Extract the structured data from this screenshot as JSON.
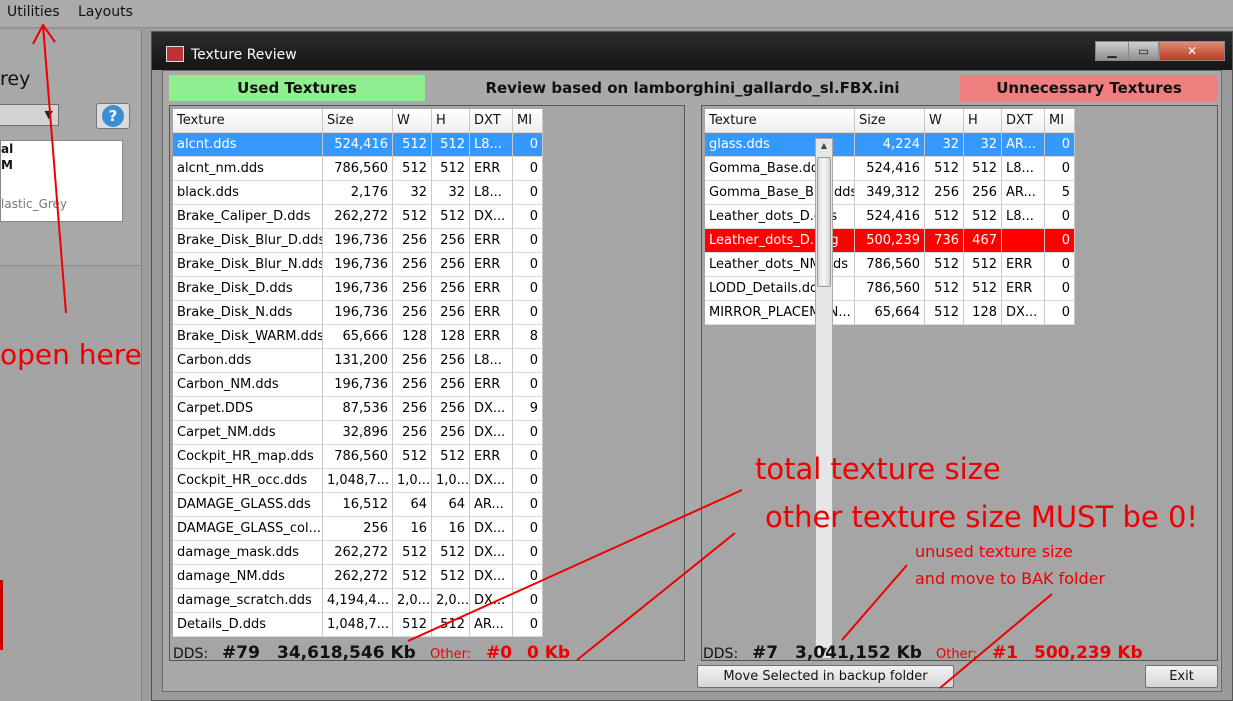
{
  "menu": {
    "utilities": "Utilities",
    "layouts": "Layouts"
  },
  "left_panel": {
    "title_fragment": "rey",
    "list": [
      "al",
      "M",
      "lastic_Grey"
    ]
  },
  "window": {
    "title": "Texture Review"
  },
  "headers": {
    "used": "Used Textures",
    "review": "Review based on lamborghini_gallardo_sl.FBX.ini",
    "unnecessary": "Unnecessary Textures",
    "used_bg": "#90f090",
    "unnecessary_bg": "#f08080"
  },
  "columns": [
    "Texture",
    "Size",
    "W",
    "H",
    "DXT",
    "MI"
  ],
  "used_rows": [
    [
      "alcnt.dds",
      "524,416",
      "512",
      "512",
      "L8...",
      "0"
    ],
    [
      "alcnt_nm.dds",
      "786,560",
      "512",
      "512",
      "ERR",
      "0"
    ],
    [
      "black.dds",
      "2,176",
      "32",
      "32",
      "L8...",
      "0"
    ],
    [
      "Brake_Caliper_D.dds",
      "262,272",
      "512",
      "512",
      "DX...",
      "0"
    ],
    [
      "Brake_Disk_Blur_D.dds",
      "196,736",
      "256",
      "256",
      "ERR",
      "0"
    ],
    [
      "Brake_Disk_Blur_N.dds",
      "196,736",
      "256",
      "256",
      "ERR",
      "0"
    ],
    [
      "Brake_Disk_D.dds",
      "196,736",
      "256",
      "256",
      "ERR",
      "0"
    ],
    [
      "Brake_Disk_N.dds",
      "196,736",
      "256",
      "256",
      "ERR",
      "0"
    ],
    [
      "Brake_Disk_WARM.dds",
      "65,666",
      "128",
      "128",
      "ERR",
      "8"
    ],
    [
      "Carbon.dds",
      "131,200",
      "256",
      "256",
      "L8...",
      "0"
    ],
    [
      "Carbon_NM.dds",
      "196,736",
      "256",
      "256",
      "ERR",
      "0"
    ],
    [
      "Carpet.DDS",
      "87,536",
      "256",
      "256",
      "DX...",
      "9"
    ],
    [
      "Carpet_NM.dds",
      "32,896",
      "256",
      "256",
      "DX...",
      "0"
    ],
    [
      "Cockpit_HR_map.dds",
      "786,560",
      "512",
      "512",
      "ERR",
      "0"
    ],
    [
      "Cockpit_HR_occ.dds",
      "1,048,7...",
      "1,0...",
      "1,0...",
      "DX...",
      "0"
    ],
    [
      "DAMAGE_GLASS.dds",
      "16,512",
      "64",
      "64",
      "AR...",
      "0"
    ],
    [
      "DAMAGE_GLASS_col...",
      "256",
      "16",
      "16",
      "DX...",
      "0"
    ],
    [
      "damage_mask.dds",
      "262,272",
      "512",
      "512",
      "DX...",
      "0"
    ],
    [
      "damage_NM.dds",
      "262,272",
      "512",
      "512",
      "DX...",
      "0"
    ],
    [
      "damage_scratch.dds",
      "4,194,4...",
      "2,0...",
      "2,0...",
      "DX...",
      "0"
    ],
    [
      "Details_D.dds",
      "1,048,7...",
      "512",
      "512",
      "AR...",
      "0"
    ]
  ],
  "unnecessary_rows": [
    [
      "glass.dds",
      "4,224",
      "32",
      "32",
      "AR...",
      "0"
    ],
    [
      "Gomma_Base.dds",
      "524,416",
      "512",
      "512",
      "L8...",
      "0"
    ],
    [
      "Gomma_Base_Blur.dds",
      "349,312",
      "256",
      "256",
      "AR...",
      "5"
    ],
    [
      "Leather_dots_D.dds",
      "524,416",
      "512",
      "512",
      "L8...",
      "0"
    ],
    [
      "Leather_dots_D.png",
      "500,239",
      "736",
      "467",
      "",
      "0"
    ],
    [
      "Leather_dots_NM.dds",
      "786,560",
      "512",
      "512",
      "ERR",
      "0"
    ],
    [
      "LODD_Details.dds",
      "786,560",
      "512",
      "512",
      "ERR",
      "0"
    ],
    [
      "MIRROR_PLACEMEN...",
      "65,664",
      "512",
      "128",
      "DX...",
      "0"
    ]
  ],
  "summary_left": {
    "dds_label": "DDS:",
    "count": "#79",
    "size": "34,618,546 Kb",
    "other_label": "Other:",
    "other_count": "#0",
    "other_size": "0 Kb"
  },
  "summary_right": {
    "dds_label": "DDS:",
    "count": "#7",
    "size": "3,041,152 Kb",
    "other_label": "Other:",
    "other_count": "#1",
    "other_size": "500,239 Kb"
  },
  "buttons": {
    "move": "Move Selected in backup folder",
    "exit": "Exit"
  },
  "annotations": {
    "open_here": "open here",
    "total_size": "total texture size",
    "other_size": "other texture size MUST be 0!",
    "unused_1": "unused texture size",
    "unused_2": "and move to BAK folder"
  }
}
